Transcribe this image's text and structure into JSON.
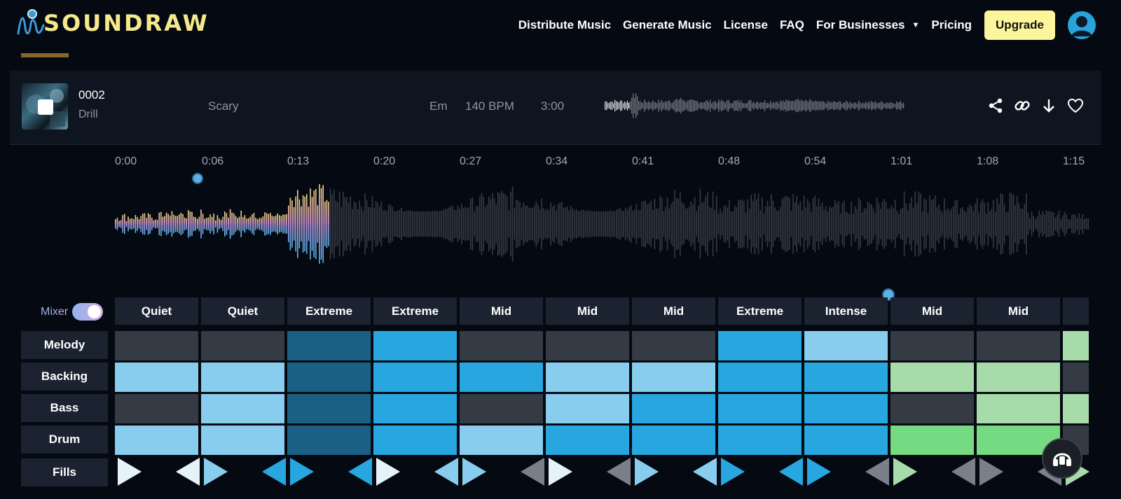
{
  "brand": {
    "name": "SOUNDRAW"
  },
  "nav": {
    "items": [
      "Distribute Music",
      "Generate Music",
      "License",
      "FAQ"
    ],
    "businesses": "For Businesses",
    "pricing": "Pricing",
    "upgrade": "Upgrade"
  },
  "track": {
    "number": "0002",
    "genre": "Drill",
    "mood": "Scary",
    "key": "Em",
    "bpm": "140 BPM",
    "duration": "3:00"
  },
  "timeline": {
    "ticks": [
      "0:00",
      "0:06",
      "0:13",
      "0:20",
      "0:27",
      "0:34",
      "0:41",
      "0:48",
      "0:54",
      "1:01",
      "1:08",
      "1:15"
    ],
    "progress": 0.22
  },
  "mixer": {
    "label": "Mixer",
    "enabled": true,
    "intensities": [
      "Quiet",
      "Quiet",
      "Extreme",
      "Extreme",
      "Mid",
      "Mid",
      "Mid",
      "Extreme",
      "Intense",
      "Mid",
      "Mid",
      ""
    ],
    "rows": [
      "Melody",
      "Backing",
      "Bass",
      "Drum",
      "Fills"
    ]
  },
  "colors": {
    "accent": "#fdf59c",
    "off": "#353b45",
    "light": "#88cdee",
    "bright": "#28a6e0",
    "dark": "#1a5f84",
    "green_light": "#a8dbaa",
    "green": "#76da83"
  }
}
